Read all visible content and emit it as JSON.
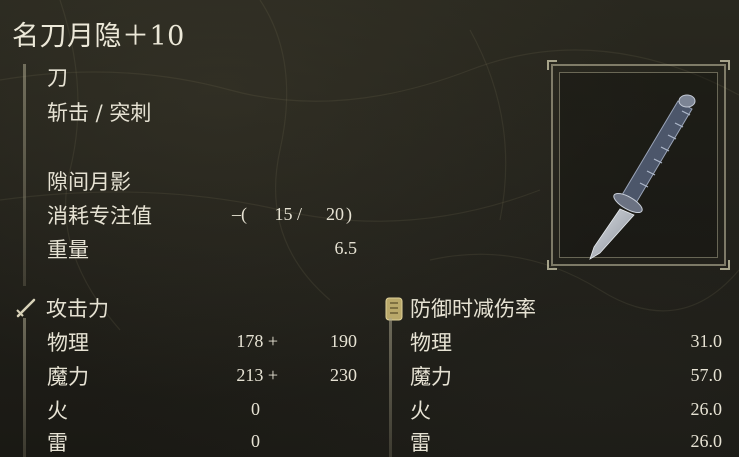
{
  "weapon": {
    "name": "名刀月隐＋10",
    "type": "刀",
    "attack_type": "斩击 / 突刺",
    "skill": "隙间月影",
    "fp_cost_label": "消耗专注值",
    "fp_cost_prefix": "–(",
    "fp_cost_1": "15 /",
    "fp_cost_2": "20",
    "fp_cost_suffix": ")",
    "weight_label": "重量",
    "weight_value": "6.5"
  },
  "attack_power": {
    "title": "攻击力",
    "icon": "sword-icon",
    "rows": [
      {
        "label": "物理",
        "base": "178 +",
        "total": "190"
      },
      {
        "label": "魔力",
        "base": "213 +",
        "total": "230"
      },
      {
        "label": "火",
        "base": "0",
        "total": ""
      },
      {
        "label": "雷",
        "base": "0",
        "total": ""
      }
    ]
  },
  "guard": {
    "title": "防御时减伤率",
    "icon": "shield-icon",
    "rows": [
      {
        "label": "物理",
        "value": "31.0"
      },
      {
        "label": "魔力",
        "value": "57.0"
      },
      {
        "label": "火",
        "value": "26.0"
      },
      {
        "label": "雷",
        "value": "26.0"
      }
    ]
  },
  "colors": {
    "text": "#e6e2d3",
    "background": "#23221b",
    "frame": "#c8c3a5"
  }
}
